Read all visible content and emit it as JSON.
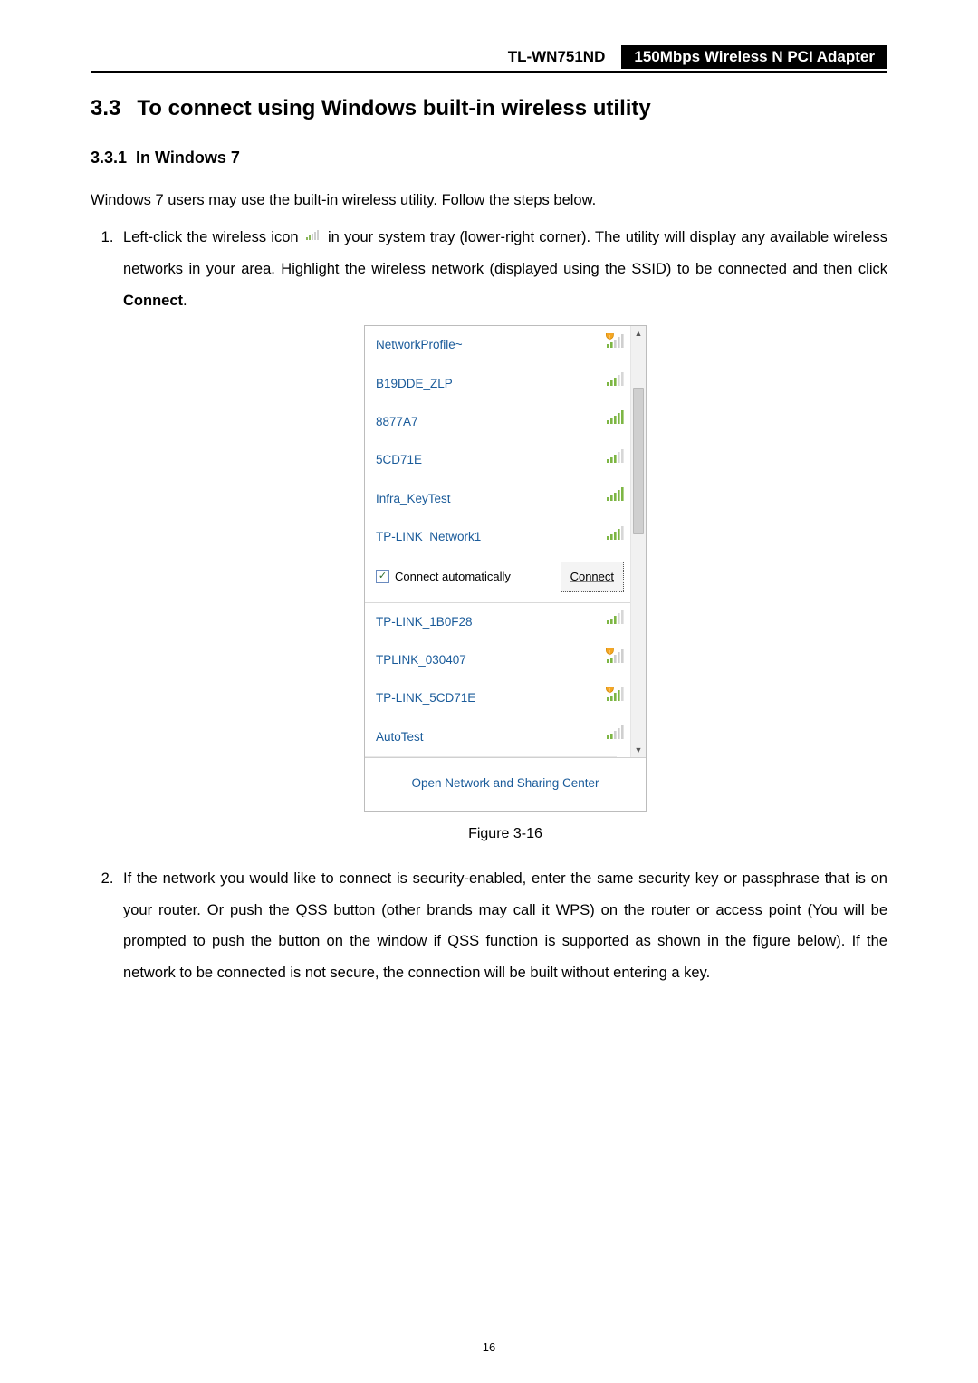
{
  "header": {
    "model": "TL-WN751ND",
    "product": "150Mbps Wireless N PCI Adapter"
  },
  "section": {
    "number": "3.3",
    "title": "To connect using Windows built-in wireless utility"
  },
  "subsection": {
    "number": "3.3.1",
    "title": "In Windows 7"
  },
  "intro": "Windows 7 users may use the built-in wireless utility. Follow the steps below.",
  "step1": {
    "part1": "Left-click the wireless icon ",
    "part2": " in your system tray (lower-right corner). The utility will display any available wireless networks in your area. Highlight the wireless network (displayed using the SSID) to be connected and then click ",
    "connect_word": "Connect",
    "part3": "."
  },
  "flyout": {
    "networks": [
      {
        "ssid": "NetworkProfile~",
        "signal": "gray",
        "shield": true
      },
      {
        "ssid": "B19DDE_ZLP",
        "signal": "weak",
        "shield": false
      },
      {
        "ssid": "8877A7",
        "signal": "full",
        "shield": false
      },
      {
        "ssid": "5CD71E",
        "signal": "weak",
        "shield": false
      },
      {
        "ssid": "Infra_KeyTest",
        "signal": "full",
        "shield": false
      },
      {
        "ssid": "TP-LINK_Network1",
        "signal": "med",
        "shield": false,
        "selected": true
      }
    ],
    "auto_connect_label": "Connect automatically",
    "auto_connect_checked": true,
    "connect_button": "Connect",
    "networks_below": [
      {
        "ssid": "TP-LINK_1B0F28",
        "signal": "weak",
        "shield": false
      },
      {
        "ssid": "TPLINK_030407",
        "signal": "gray",
        "shield": true
      },
      {
        "ssid": "TP-LINK_5CD71E",
        "signal": "med",
        "shield": true
      },
      {
        "ssid": "AutoTest",
        "signal": "gray",
        "shield": false
      }
    ],
    "open_link": "Open Network and Sharing Center"
  },
  "figure_caption": "Figure 3-16",
  "step2": "If the network you would like to connect is security-enabled, enter the same security key or passphrase that is on your router. Or push the QSS button (other brands may call it WPS) on the router or access point (You will be prompted to push the button on the window if QSS function is supported as shown in the figure below). If the network to be connected is not secure, the connection will be built without entering a key.",
  "page_number": "16"
}
